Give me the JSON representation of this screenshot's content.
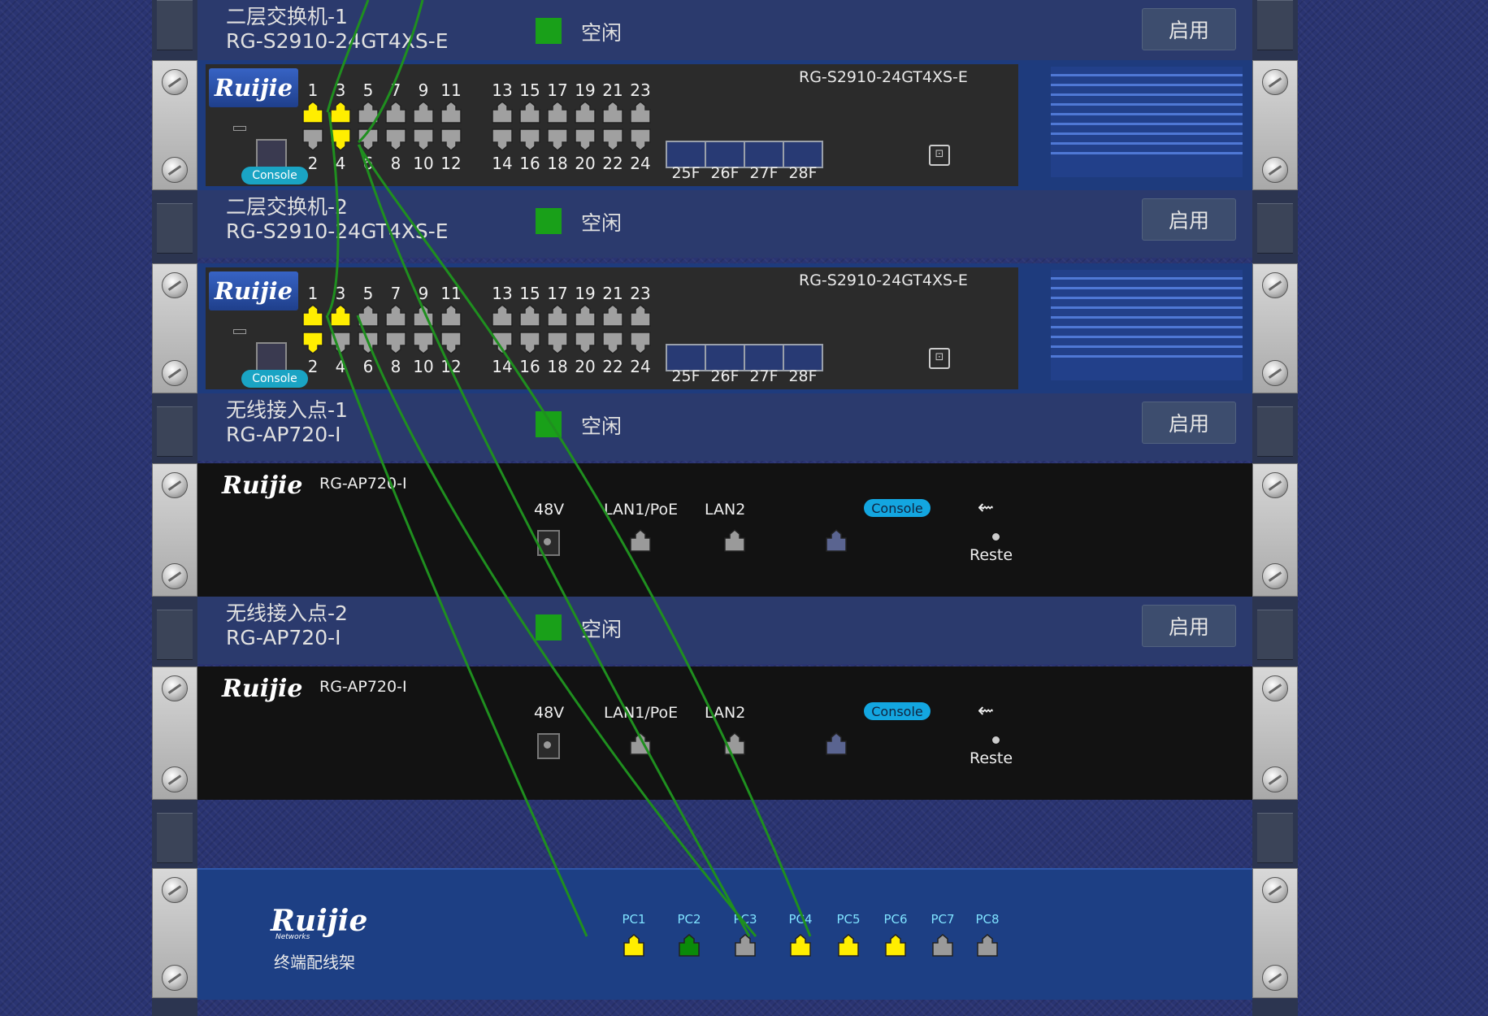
{
  "devices": {
    "switch1": {
      "name": "二层交换机-1",
      "model": "RG-S2910-24GT4XS-E",
      "status": "空闲",
      "button": "启用",
      "brand": "Ruijie",
      "face_model": "RG-S2910-24GT4XS-E",
      "console": "Console"
    },
    "switch2": {
      "name": "二层交换机-2",
      "model": "RG-S2910-24GT4XS-E",
      "status": "空闲",
      "button": "启用",
      "brand": "Ruijie",
      "face_model": "RG-S2910-24GT4XS-E",
      "console": "Console"
    },
    "ap1": {
      "name": "无线接入点-1",
      "model": "RG-AP720-I",
      "status": "空闲",
      "button": "启用",
      "brand": "Ruijie",
      "face_model": "RG-AP720-I"
    },
    "ap2": {
      "name": "无线接入点-2",
      "model": "RG-AP720-I",
      "status": "空闲",
      "button": "启用",
      "brand": "Ruijie",
      "face_model": "RG-AP720-I"
    }
  },
  "switch_ports": {
    "top_numbers": [
      "1",
      "3",
      "5",
      "7",
      "9",
      "11",
      "13",
      "15",
      "17",
      "19",
      "21",
      "23"
    ],
    "bottom_numbers": [
      "2",
      "4",
      "6",
      "8",
      "10",
      "12",
      "14",
      "16",
      "18",
      "20",
      "22",
      "24"
    ],
    "sfp": [
      "25F",
      "26F",
      "27F",
      "28F"
    ],
    "switch1_active": [
      "1",
      "3",
      "4"
    ],
    "switch2_active": [
      "1",
      "2",
      "3"
    ]
  },
  "ap_ports": {
    "dc": "48V",
    "lan1": "LAN1/PoE",
    "lan2": "LAN2",
    "console": "Console",
    "usb": "⇜",
    "reset": "Reste"
  },
  "patch_panel": {
    "brand": "Ruijie",
    "brand_sub": "Networks",
    "name": "终端配线架",
    "ports": [
      "PC1",
      "PC2",
      "PC3",
      "PC4",
      "PC5",
      "PC6",
      "PC7",
      "PC8"
    ],
    "port_states": [
      "active",
      "link",
      "idle",
      "active",
      "active",
      "active",
      "idle",
      "idle"
    ]
  },
  "colors": {
    "active": "#ffee00",
    "link": "#0a8a0a",
    "idle": "#9a9a9a",
    "cable": "#1f8f1f",
    "status_led": "#19a019"
  }
}
